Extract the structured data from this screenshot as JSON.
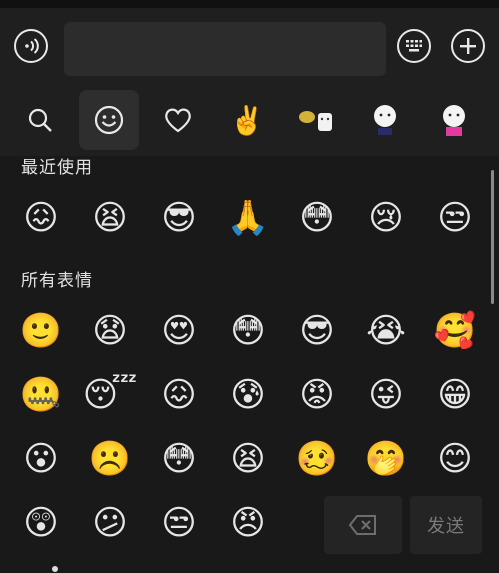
{
  "input": {
    "value": "",
    "placeholder": ""
  },
  "tabs": [
    {
      "name": "search",
      "icon": "search-icon"
    },
    {
      "name": "emoji",
      "icon": "smiley-icon",
      "active": true
    },
    {
      "name": "favorites",
      "icon": "heart-icon"
    },
    {
      "name": "gestures",
      "icon": "victory-hand-icon"
    },
    {
      "name": "sticker-pack-1",
      "icon": "sticker-icon"
    },
    {
      "name": "sticker-pack-2",
      "icon": "sticker-icon"
    },
    {
      "name": "sticker-pack-3",
      "icon": "sticker-icon"
    }
  ],
  "sections": {
    "recent_title": "最近使用",
    "all_title": "所有表情"
  },
  "recent": [
    "😖",
    "😫",
    "😎",
    "🙏",
    "😳",
    "😢",
    "😒"
  ],
  "all_rows": [
    [
      "🙂",
      "😧",
      "😍",
      "😳",
      "😎",
      "😭",
      "🥰"
    ],
    [
      "🤐",
      "😴",
      "😖",
      "😰",
      "😡",
      "😜",
      "😁"
    ],
    [
      "😮",
      "☹️",
      "😳",
      "😫",
      "🥴",
      "🤭",
      "😊"
    ],
    [
      "😲",
      "😕",
      "😒",
      "😠"
    ]
  ],
  "actions": {
    "delete_icon": "backspace-icon",
    "send_label": "发送"
  },
  "colors": {
    "background": "#191919",
    "panel": "#1f1f1f",
    "input": "#2c2c2c"
  }
}
